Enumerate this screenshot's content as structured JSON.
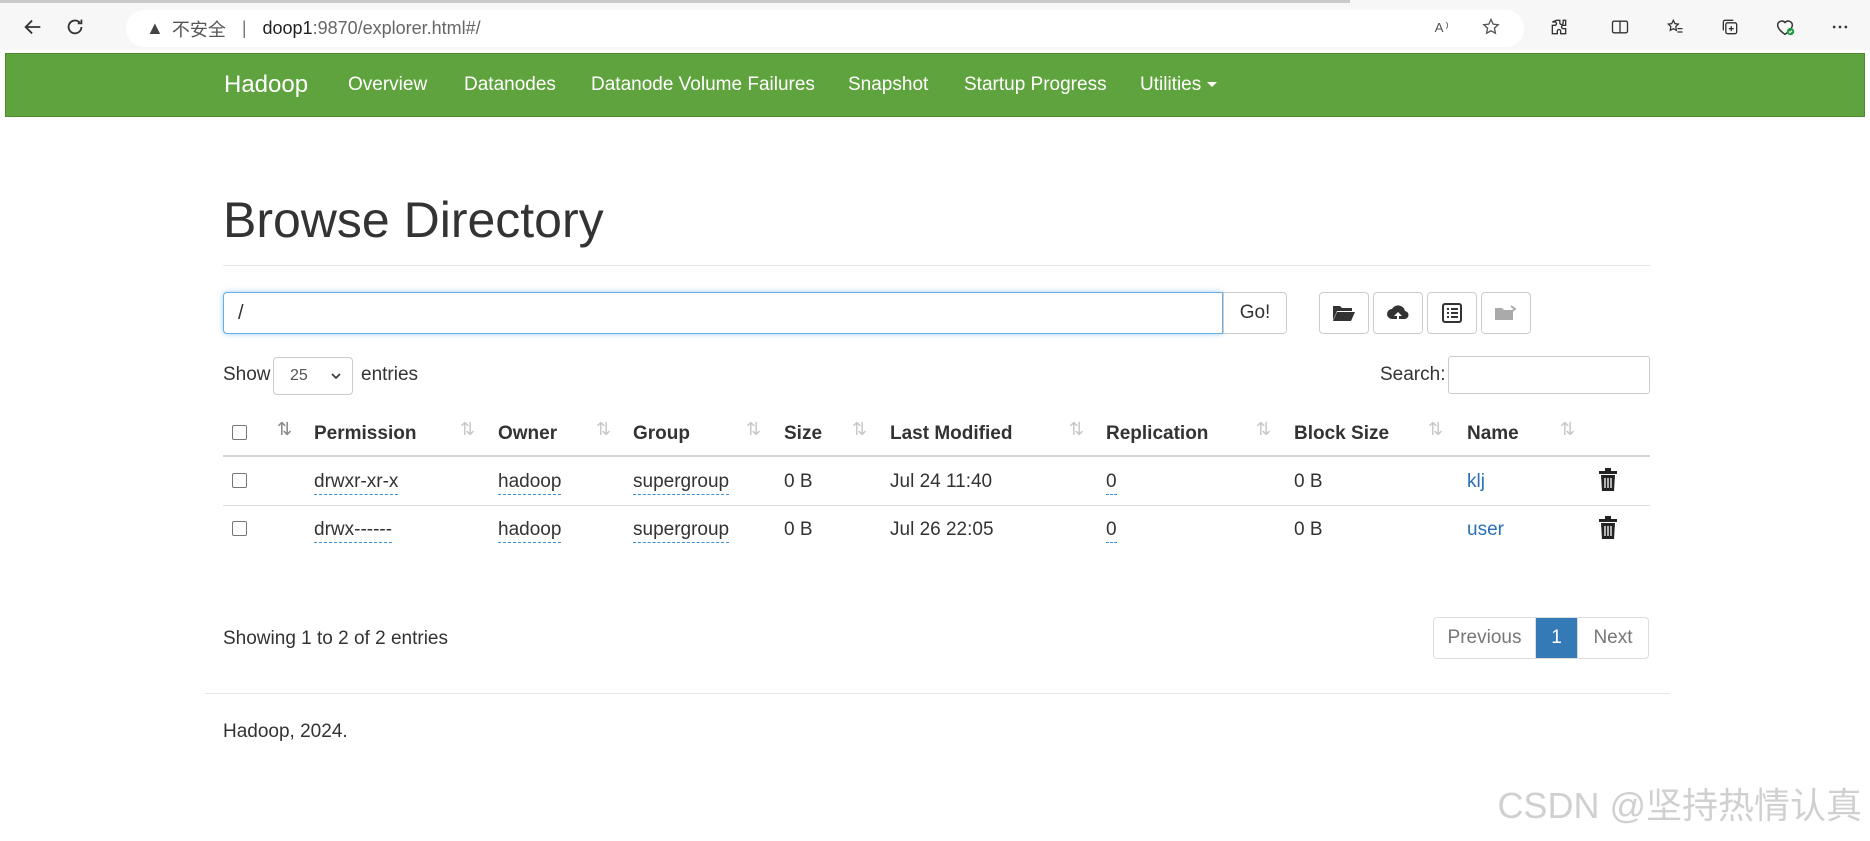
{
  "browser": {
    "security_warning": "不安全",
    "url_host": "doop1",
    "url_path": ":9870/explorer.html#/"
  },
  "navbar": {
    "brand": "Hadoop",
    "items": [
      "Overview",
      "Datanodes",
      "Datanode Volume Failures",
      "Snapshot",
      "Startup Progress",
      "Utilities"
    ]
  },
  "page": {
    "title": "Browse Directory",
    "path_value": "/",
    "go_label": "Go!"
  },
  "controls": {
    "show_label": "Show",
    "entries_value": "25",
    "entries_label": "entries",
    "search_label": "Search:"
  },
  "table": {
    "headers": [
      "Permission",
      "Owner",
      "Group",
      "Size",
      "Last Modified",
      "Replication",
      "Block Size",
      "Name"
    ],
    "rows": [
      {
        "permission": "drwxr-xr-x",
        "owner": "hadoop",
        "group": "supergroup",
        "size": "0 B",
        "modified": "Jul 24 11:40",
        "replication": "0",
        "block_size": "0 B",
        "name": "klj"
      },
      {
        "permission": "drwx------",
        "owner": "hadoop",
        "group": "supergroup",
        "size": "0 B",
        "modified": "Jul 26 22:05",
        "replication": "0",
        "block_size": "0 B",
        "name": "user"
      }
    ]
  },
  "summary": {
    "showing": "Showing 1 to 2 of 2 entries"
  },
  "pagination": {
    "previous": "Previous",
    "current": "1",
    "next": "Next"
  },
  "footer": {
    "text": "Hadoop, 2024."
  },
  "watermark": "CSDN @坚持热情认真"
}
